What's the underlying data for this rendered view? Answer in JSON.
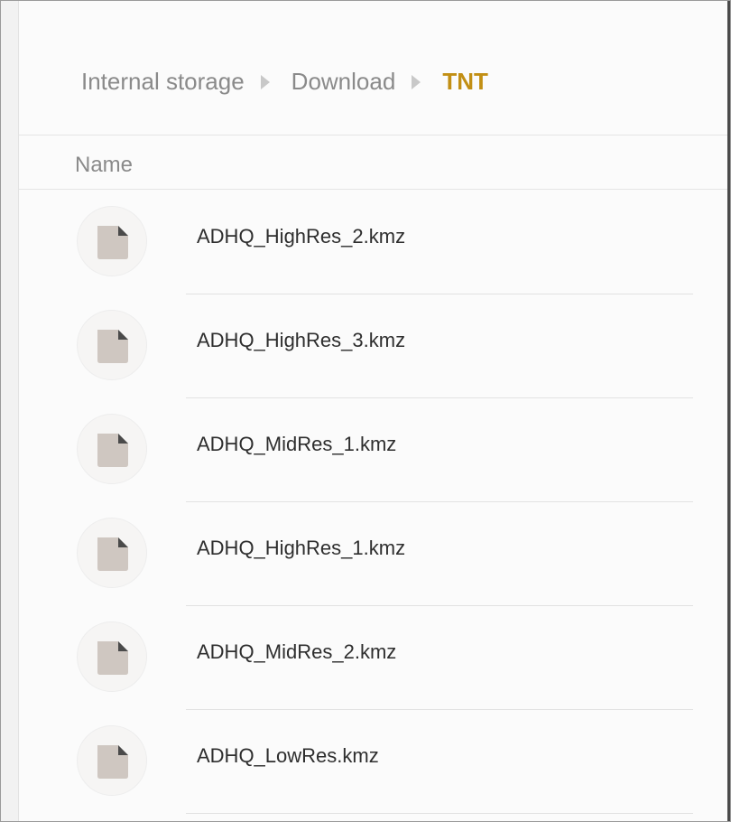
{
  "breadcrumb": {
    "items": [
      "Internal storage",
      "Download"
    ],
    "current": "TNT"
  },
  "list_header": {
    "name_label": "Name"
  },
  "files": [
    {
      "name": "ADHQ_HighRes_2.kmz",
      "icon": "file-icon"
    },
    {
      "name": "ADHQ_HighRes_3.kmz",
      "icon": "file-icon"
    },
    {
      "name": "ADHQ_MidRes_1.kmz",
      "icon": "file-icon"
    },
    {
      "name": "ADHQ_HighRes_1.kmz",
      "icon": "file-icon"
    },
    {
      "name": "ADHQ_MidRes_2.kmz",
      "icon": "file-icon"
    },
    {
      "name": "ADHQ_LowRes.kmz",
      "icon": "file-icon"
    }
  ],
  "colors": {
    "accent": "#c28f14",
    "icon_fill": "#cfc7c1"
  }
}
